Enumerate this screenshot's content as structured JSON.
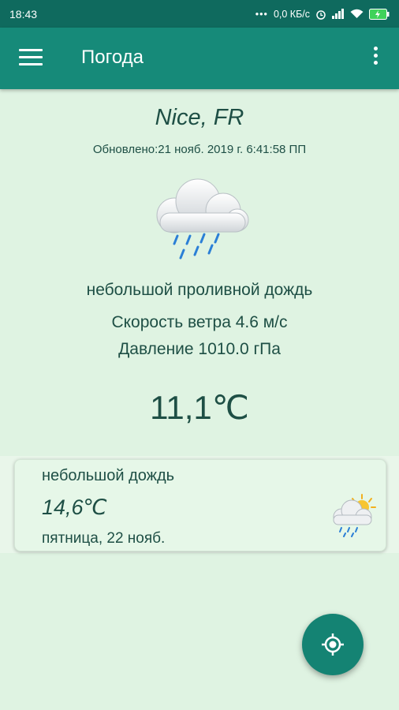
{
  "status_bar": {
    "time": "18:43",
    "net_speed": "0,0 КБ/с",
    "icons": [
      "alarm-icon",
      "signal-icon",
      "wifi-icon",
      "battery-charging-icon"
    ]
  },
  "app_bar": {
    "title": "Погода",
    "menu_icon": "hamburger-menu-icon",
    "overflow_icon": "more-vert-icon"
  },
  "current": {
    "city": "Nice, FR",
    "updated": "Обновлено:21 нояб. 2019 г. 6:41:58 ПП",
    "icon": "rain-cloud-icon",
    "description": "небольшой проливной дождь",
    "wind": "Скорость ветра 4.6 м/с",
    "pressure": "Давление 1010.0 гПа",
    "temperature": "11,1℃"
  },
  "forecast": [
    {
      "description": "небольшой дождь",
      "temperature": "14,6℃",
      "date": "пятница, 22 нояб.",
      "icon": "sun-cloud-rain-icon"
    }
  ],
  "fab": {
    "icon": "my-location-icon"
  },
  "colors": {
    "status_bar": "#0f6a5e",
    "app_bar": "#168a79",
    "background": "#dff3e2",
    "text": "#1e4f45",
    "fab": "#148373"
  }
}
